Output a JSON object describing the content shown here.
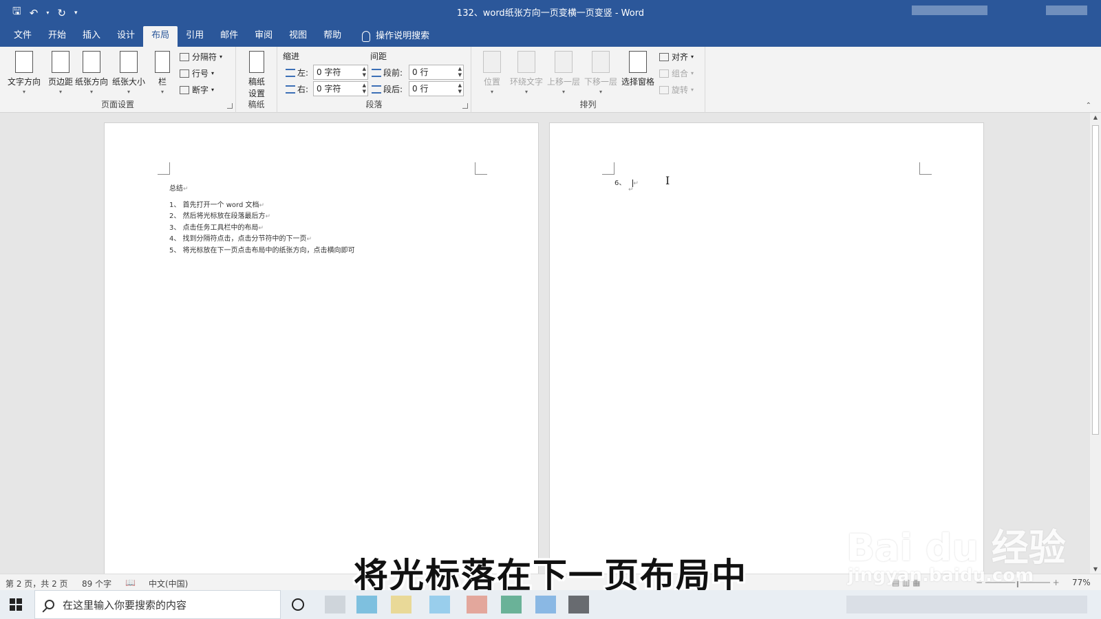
{
  "window": {
    "title": "132、word纸张方向一页变横一页变竖 - Word",
    "qat_icons": [
      "save-icon",
      "undo-icon",
      "redo-icon",
      "customize-icon"
    ]
  },
  "tabs": [
    "文件",
    "开始",
    "插入",
    "设计",
    "布局",
    "引用",
    "邮件",
    "审阅",
    "视图",
    "帮助"
  ],
  "active_tab": "布局",
  "tell_me": "操作说明搜索",
  "ribbon": {
    "page_setup": {
      "label": "页面设置",
      "text_direction": "文字方向",
      "margins": "页边距",
      "orientation": "纸张方向",
      "size": "纸张大小",
      "columns": "栏",
      "breaks": "分隔符",
      "line_numbers": "行号",
      "hyphenation": "断字"
    },
    "manuscript": {
      "label": "稿纸",
      "settings_line1": "稿纸",
      "settings_line2": "设置"
    },
    "paragraph": {
      "label": "段落",
      "indent_header": "缩进",
      "spacing_header": "间距",
      "left_label": "左:",
      "left_value": "0 字符",
      "right_label": "右:",
      "right_value": "0 字符",
      "before_label": "段前:",
      "before_value": "0 行",
      "after_label": "段后:",
      "after_value": "0 行"
    },
    "arrange": {
      "label": "排列",
      "position": "位置",
      "wrap_text": "环绕文字",
      "bring_forward": "上移一层",
      "send_backward": "下移一层",
      "selection_pane": "选择窗格",
      "align": "对齐",
      "group": "组合",
      "rotate": "旋转"
    }
  },
  "document": {
    "page1": {
      "heading": "总结",
      "items": [
        "1、 首先打开一个 word 文档",
        "2、 然后将光标放在段落最后方",
        "3、 点击任务工具栏中的布局",
        "4、 找到分隔符点击，点击分节符中的下一页",
        "5、 将光标放在下一页点击布局中的纸张方向，点击横向即可"
      ],
      "para_mark": "↵"
    },
    "page2": {
      "item": "6、",
      "para_mark": "↵"
    }
  },
  "status": {
    "page": "第 2 页，共 2 页",
    "words": "89 个字",
    "language": "中文(中国)",
    "zoom": "77%"
  },
  "subtitle": "将光标落在下一页布局中",
  "watermark": {
    "brand": "Bai du 经验",
    "url": "jingyan.baidu.com"
  },
  "taskbar": {
    "search_placeholder": "在这里输入你要搜索的内容"
  }
}
